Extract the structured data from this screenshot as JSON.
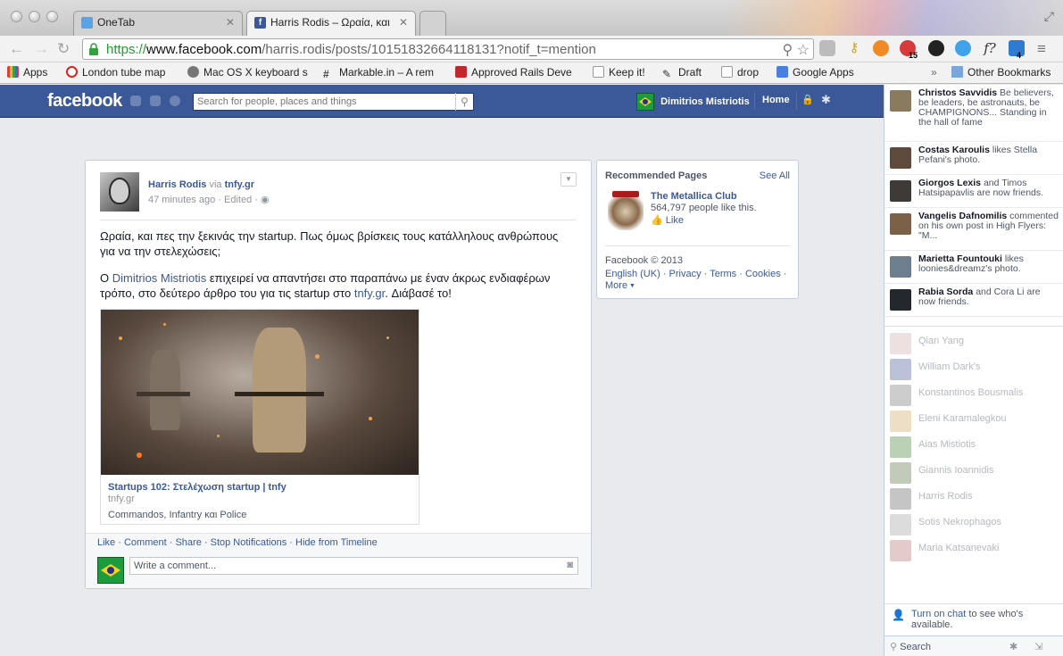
{
  "browser": {
    "tabs": [
      {
        "title": "OneTab",
        "active": false
      },
      {
        "title": "Harris Rodis – Ωραία, και",
        "active": true
      }
    ],
    "url": {
      "scheme": "https://",
      "host": "www.facebook.com",
      "path": "/harris.rodis/posts/10151832664118131?notif_t=mention"
    },
    "badges": {
      "ext1": "15",
      "ext2": "4"
    },
    "bookmarks": [
      {
        "label": "Apps",
        "color": "#e0403a"
      },
      {
        "label": "London tube map",
        "color": "#1b3fa0"
      },
      {
        "label": "Mac OS X keyboard s",
        "color": "#777777"
      },
      {
        "label": "Markable.in – A rem",
        "color": "#444444"
      },
      {
        "label": "Approved Rails Deve",
        "color": "#c0282d"
      },
      {
        "label": "Keep it!",
        "color": "#ffffff"
      },
      {
        "label": "Draft",
        "color": "#333333"
      },
      {
        "label": "drop",
        "color": "#ffffff"
      },
      {
        "label": "Google Apps",
        "color": "#4a7fe0"
      }
    ],
    "overflow": "»",
    "other_bookmarks": "Other Bookmarks"
  },
  "facebook": {
    "logo": "facebook",
    "search_placeholder": "Search for people, places and things",
    "user_name": "Dimitrios Mistriotis",
    "home": "Home"
  },
  "post": {
    "author": "Harris Rodis",
    "via": "via",
    "via_target": "tnfy.gr",
    "time": "47 minutes ago",
    "edited": "Edited",
    "meta_sep": "·",
    "para1": "Ωραία, και πες την ξεκινάς την startup. Πως όμως βρίσκεις τους κατάλληλους ανθρώπους για να την στελεχώσεις;",
    "para2_prefix": "Ο",
    "para2_mention": "Dimitrios Mistriotis",
    "para2_mid": "επιχειρεί να απαντήσει στο παραπάνω με έναν άκρως ενδιαφέρων τρόπο, στο δεύτερο άρθρο του για τις startup στο",
    "para2_link": "tnfy.gr",
    "para2_suffix": ". Διάβασέ το!",
    "share": {
      "title": "Startups 102: Στελέχωση startup | tnfy",
      "host": "tnfy.gr",
      "description": "Commandos, Infantry και Police"
    },
    "actions": [
      "Like",
      "Comment",
      "Share",
      "Stop Notifications",
      "Hide from Timeline"
    ],
    "comment_placeholder": "Write a comment..."
  },
  "recommended": {
    "heading": "Recommended Pages",
    "see_all": "See All",
    "page_name": "The Metallica Club",
    "page_likes": "564,797 people like this.",
    "like": "Like",
    "copyright": "Facebook © 2013",
    "links": [
      "English (UK)",
      "Privacy",
      "Terms",
      "Cookies",
      "More"
    ]
  },
  "ticker": [
    {
      "name": "Christos Savvidis",
      "text": " Be believers, be leaders, be astronauts, be CHAMPIGNONS... Standing in the hall of fame",
      "color": "#8a7a5e",
      "size": "big"
    },
    {
      "name": "Costas Karoulis",
      "text": " likes Stella Pefani's photo.",
      "color": "#5d4a3c",
      "size": "normal"
    },
    {
      "name": "Giorgos Lexis",
      "text": " and Timos Hatsipapavlis are now friends.",
      "color": "#3d3a38",
      "size": "med"
    },
    {
      "name": "Vangelis Dafnomilis",
      "text": " commented on his own post in High Flyers: \"M...",
      "color": "#7a6148",
      "size": "med"
    },
    {
      "name": "Marietta Fountouki",
      "text": " likes loonies&dreamz's photo.",
      "color": "#6d7f8f",
      "size": "med"
    },
    {
      "name": "Rabia Sorda",
      "text": " and Cora Li are now friends.",
      "color": "#24272b",
      "size": "normal"
    }
  ],
  "chat": [
    {
      "name": "Qian Yang",
      "color": "#c9a5a5"
    },
    {
      "name": "William Dark's",
      "color": "#3b4e8c"
    },
    {
      "name": "Konstantinos Bousmalis",
      "color": "#6e6e6e"
    },
    {
      "name": "Eleni Karamalegkou",
      "color": "#c9a35a"
    },
    {
      "name": "Aias Mistiotis",
      "color": "#3a7a2a"
    },
    {
      "name": "Giannis Ioannidis",
      "color": "#4f6b3a"
    },
    {
      "name": "Harris Rodis",
      "color": "#5a5a5a"
    },
    {
      "name": "Sotis Nekrophagos",
      "color": "#9a9a9a"
    },
    {
      "name": "Maria Katsanevaki",
      "color": "#b06a6a"
    }
  ],
  "chat_footer": {
    "link": "Turn on chat",
    "text": " to see who's available.",
    "search": "Search"
  }
}
